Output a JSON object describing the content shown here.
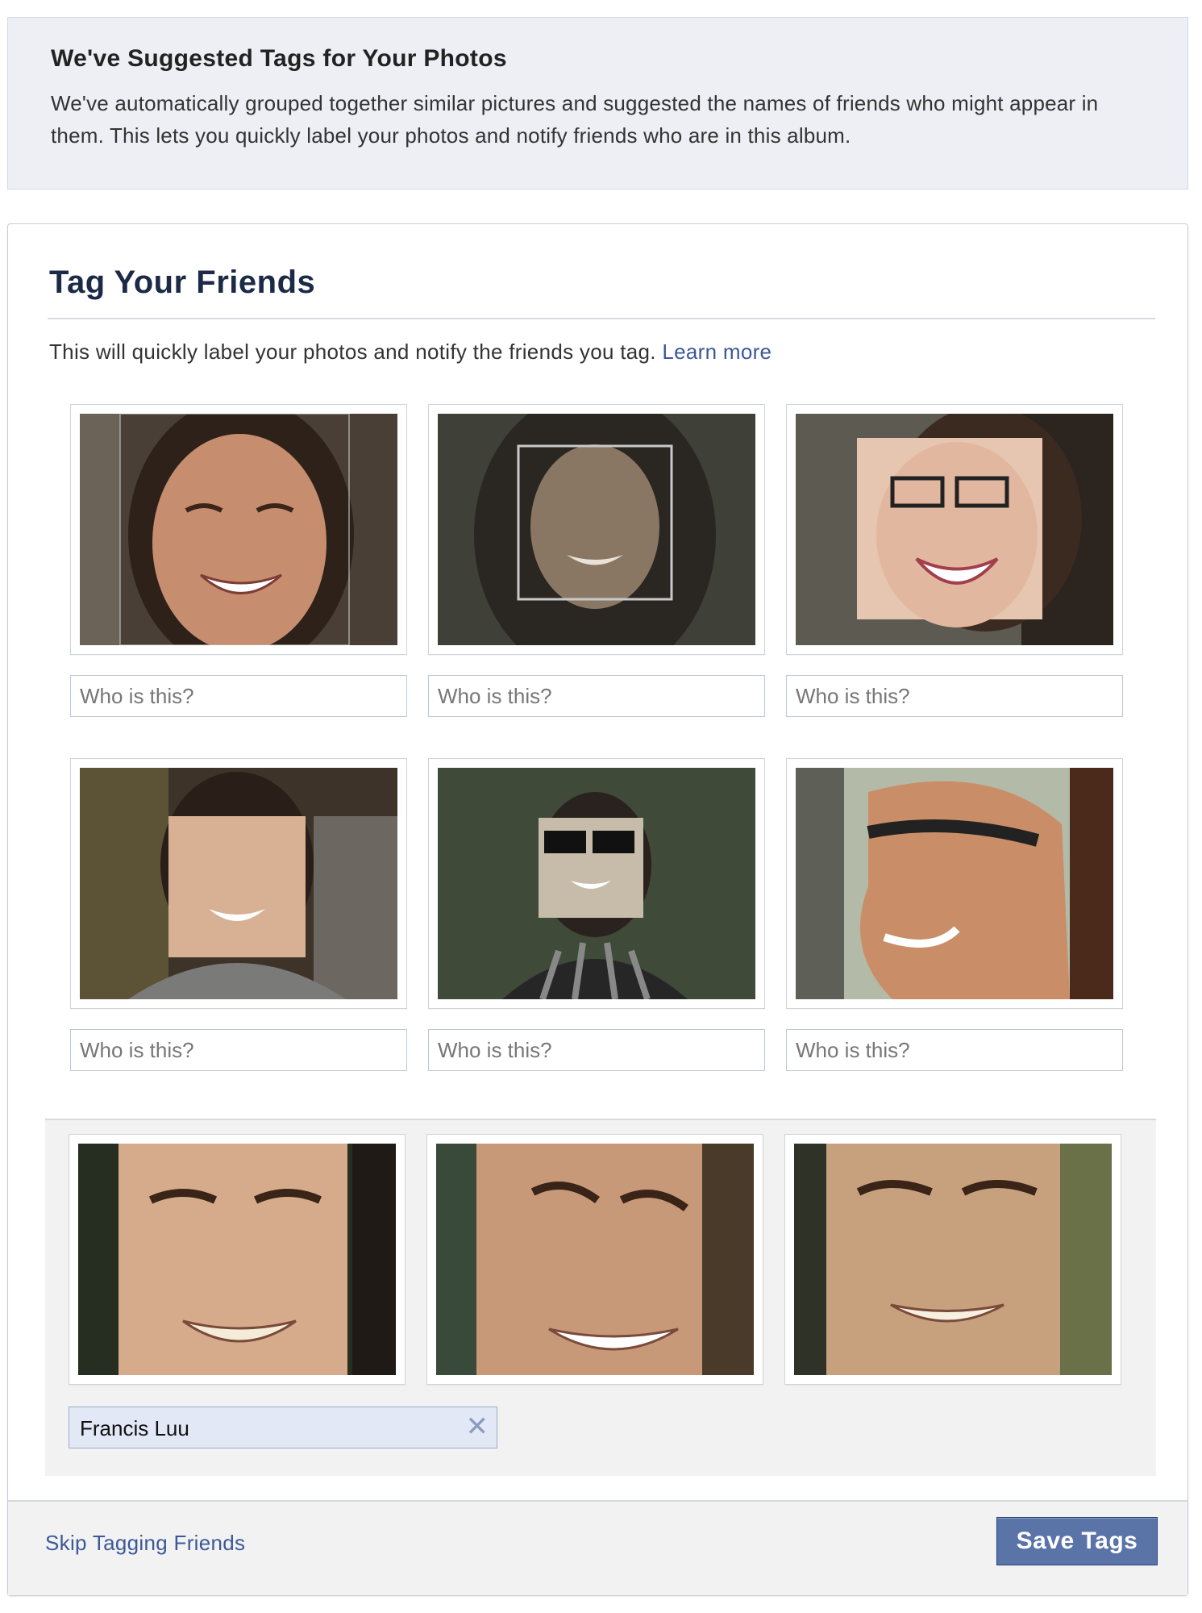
{
  "notice": {
    "title": "We've Suggested Tags for Your Photos",
    "body": "We've automatically grouped together similar pictures and suggested the names of friends who might appear in them. This lets you quickly label your photos and notify friends who are in this album."
  },
  "card": {
    "heading": "Tag Your Friends",
    "intro": "This will quickly label your photos and notify the friends you tag.",
    "learn_more": "Learn more"
  },
  "untagged_faces": {
    "placeholder": "Who is this?",
    "count": 6
  },
  "confirmed_group": {
    "name": "Francis Luu",
    "remove_icon": "close-icon",
    "count": 3
  },
  "footer": {
    "skip_label": "Skip Tagging Friends",
    "save_label": "Save Tags"
  },
  "colors": {
    "link": "#3b5998",
    "button": "#5b74a8",
    "token": "#e2e8f6",
    "notice_bg": "#edeff4"
  }
}
